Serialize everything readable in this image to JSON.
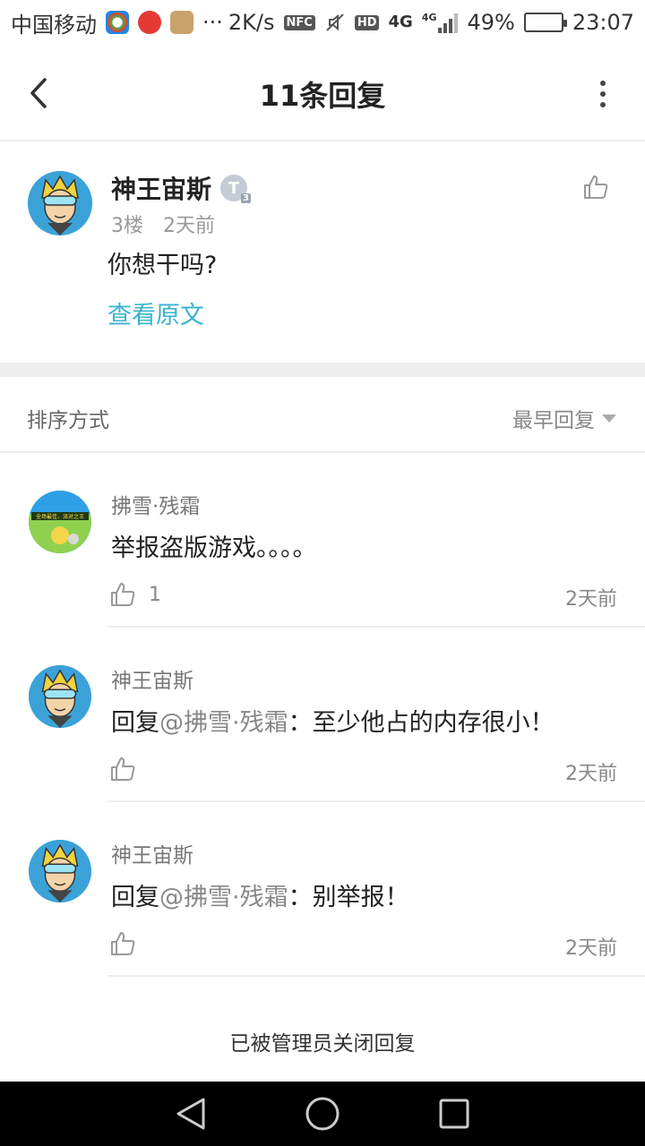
{
  "status_bar": {
    "carrier": "中国移动",
    "more": "···",
    "speed": "2K/s",
    "nfc": "NFC",
    "hd": "HD",
    "network": "4G",
    "network_small": "4G",
    "battery": "49%",
    "battery_level": 0.49,
    "time": "23:07"
  },
  "header": {
    "title": "11条回复"
  },
  "main_post": {
    "author": "神王宙斯",
    "badge": "T",
    "badge_level": "3",
    "floor": "3楼",
    "time": "2天前",
    "content": "你想干吗?",
    "view_original": "查看原文"
  },
  "sort": {
    "label": "排序方式",
    "value": "最早回复"
  },
  "replies": [
    {
      "author": "拂雪·残霜",
      "mention_prefix": "",
      "mention": "",
      "content": "举报盗版游戏。。。。",
      "likes": "1",
      "time": "2天前",
      "avatar_caption": "全场最佳，派对之王"
    },
    {
      "author": "神王宙斯",
      "mention_prefix": "回复",
      "mention": "@拂雪·残霜",
      "content": "：至少他占的内存很小！",
      "likes": "",
      "time": "2天前"
    },
    {
      "author": "神王宙斯",
      "mention_prefix": "回复",
      "mention": "@拂雪·残霜",
      "content": "：别举报！",
      "likes": "",
      "time": "2天前"
    }
  ],
  "footer": {
    "closed_note": "已被管理员关闭回复"
  }
}
